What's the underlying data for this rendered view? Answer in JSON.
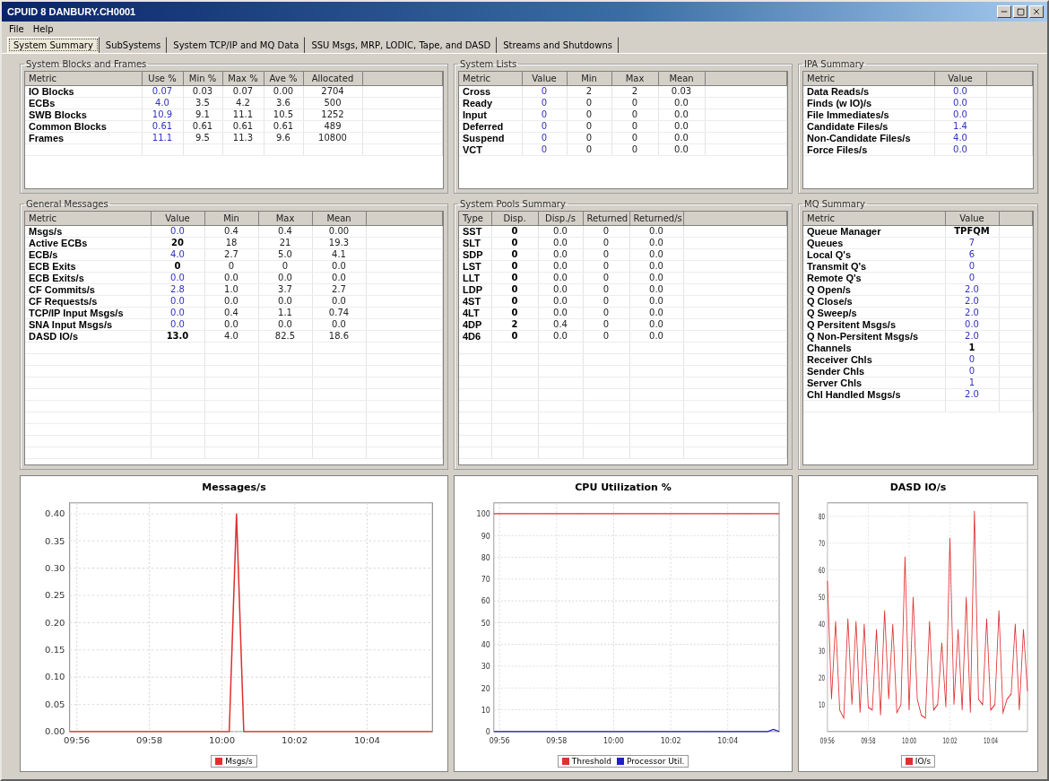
{
  "window": {
    "title": "CPUID 8 DANBURY.CH0001"
  },
  "menu": [
    "File",
    "Help"
  ],
  "tabs": [
    {
      "label": "System Summary",
      "selected": true
    },
    {
      "label": "SubSystems",
      "selected": false
    },
    {
      "label": "System TCP/IP and MQ Data",
      "selected": false
    },
    {
      "label": "SSU Msgs, MRP, LODIC, Tape, and DASD",
      "selected": false
    },
    {
      "label": "Streams and Shutdowns",
      "selected": false
    }
  ],
  "panels": [
    {
      "title": "System Blocks and Frames",
      "columns": [
        "Metric",
        "Use %",
        "Min %",
        "Max %",
        "Ave %",
        "Allocated"
      ],
      "rows": [
        {
          "metric": "IO Blocks",
          "values": [
            "0.07",
            "0.03",
            "0.07",
            "0.00",
            "2704"
          ],
          "highlighted": true
        },
        {
          "metric": "ECBs",
          "values": [
            "4.0",
            "3.5",
            "4.2",
            "3.6",
            "500"
          ],
          "highlighted": true
        },
        {
          "metric": "SWB Blocks",
          "values": [
            "10.9",
            "9.1",
            "11.1",
            "10.5",
            "1252"
          ],
          "highlighted": true
        },
        {
          "metric": "Common Blocks",
          "values": [
            "0.61",
            "0.61",
            "0.61",
            "0.61",
            "489"
          ],
          "highlighted": true
        },
        {
          "metric": "Frames",
          "values": [
            "11.1",
            "9.5",
            "11.3",
            "9.6",
            "10800"
          ],
          "highlighted": true
        }
      ]
    },
    {
      "title": "System Lists",
      "columns": [
        "Metric",
        "Value",
        "Min",
        "Max",
        "Mean"
      ],
      "rows": [
        {
          "metric": "Cross",
          "values": [
            "0",
            "2",
            "2",
            "0.03"
          ],
          "highlighted": true
        },
        {
          "metric": "Ready",
          "values": [
            "0",
            "0",
            "0",
            "0.0"
          ],
          "highlighted": true
        },
        {
          "metric": "Input",
          "values": [
            "0",
            "0",
            "0",
            "0.0"
          ],
          "highlighted": true
        },
        {
          "metric": "Deferred",
          "values": [
            "0",
            "0",
            "0",
            "0.0"
          ],
          "highlighted": true
        },
        {
          "metric": "Suspend",
          "values": [
            "0",
            "0",
            "0",
            "0.0"
          ],
          "highlighted": true
        },
        {
          "metric": "VCT",
          "values": [
            "0",
            "0",
            "0",
            "0.0"
          ],
          "highlighted": true
        }
      ]
    },
    {
      "title": "IPA Summary",
      "columns": [
        "Metric",
        "Value"
      ],
      "rows": [
        {
          "metric": "Data Reads/s",
          "values": [
            "0.0"
          ],
          "highlighted": true
        },
        {
          "metric": "Finds (w IO)/s",
          "values": [
            "0.0"
          ],
          "highlighted": true
        },
        {
          "metric": "File Immediates/s",
          "values": [
            "0.0"
          ],
          "highlighted": true
        },
        {
          "metric": "Candidate Files/s",
          "values": [
            "1.4"
          ],
          "highlighted": true
        },
        {
          "metric": "Non-Candidate Files/s",
          "values": [
            "4.0"
          ],
          "highlighted": true
        },
        {
          "metric": "Force Files/s",
          "values": [
            "0.0"
          ],
          "highlighted": true
        }
      ]
    },
    {
      "title": "General Messages",
      "columns": [
        "Metric",
        "Value",
        "Min",
        "Max",
        "Mean"
      ],
      "rows": [
        {
          "metric": "Msgs/s",
          "values": [
            "0.0",
            "0.4",
            "0.4",
            "0.00"
          ],
          "highlighted": true
        },
        {
          "metric": "Active ECBs",
          "values": [
            "20",
            "18",
            "21",
            "19.3"
          ],
          "highlighted": false
        },
        {
          "metric": "ECB/s",
          "values": [
            "4.0",
            "2.7",
            "5.0",
            "4.1"
          ],
          "highlighted": true
        },
        {
          "metric": "ECB Exits",
          "values": [
            "0",
            "0",
            "0",
            "0.0"
          ],
          "highlighted": false
        },
        {
          "metric": "ECB Exits/s",
          "values": [
            "0.0",
            "0.0",
            "0.0",
            "0.0"
          ],
          "highlighted": true
        },
        {
          "metric": "CF Commits/s",
          "values": [
            "2.8",
            "1.0",
            "3.7",
            "2.7"
          ],
          "highlighted": true
        },
        {
          "metric": "CF Requests/s",
          "values": [
            "0.0",
            "0.0",
            "0.0",
            "0.0"
          ],
          "highlighted": true
        },
        {
          "metric": "TCP/IP Input Msgs/s",
          "values": [
            "0.0",
            "0.4",
            "1.1",
            "0.74"
          ],
          "highlighted": true
        },
        {
          "metric": "SNA Input Msgs/s",
          "values": [
            "0.0",
            "0.0",
            "0.0",
            "0.0"
          ],
          "highlighted": true
        },
        {
          "metric": "DASD IO/s",
          "values": [
            "13.0",
            "4.0",
            "82.5",
            "18.6"
          ],
          "highlighted": false
        }
      ]
    },
    {
      "title": "System Pools Summary",
      "columns": [
        "Type",
        "Disp.",
        "Disp./s",
        "Returned",
        "Returned/s"
      ],
      "rows": [
        {
          "metric": "SST",
          "values": [
            "0",
            "0.0",
            "0",
            "0.0"
          ],
          "highlighted": false
        },
        {
          "metric": "SLT",
          "values": [
            "0",
            "0.0",
            "0",
            "0.0"
          ],
          "highlighted": false
        },
        {
          "metric": "SDP",
          "values": [
            "0",
            "0.0",
            "0",
            "0.0"
          ],
          "highlighted": false
        },
        {
          "metric": "LST",
          "values": [
            "0",
            "0.0",
            "0",
            "0.0"
          ],
          "highlighted": false
        },
        {
          "metric": "LLT",
          "values": [
            "0",
            "0.0",
            "0",
            "0.0"
          ],
          "highlighted": false
        },
        {
          "metric": "LDP",
          "values": [
            "0",
            "0.0",
            "0",
            "0.0"
          ],
          "highlighted": false
        },
        {
          "metric": "4ST",
          "values": [
            "0",
            "0.0",
            "0",
            "0.0"
          ],
          "highlighted": false
        },
        {
          "metric": "4LT",
          "values": [
            "0",
            "0.0",
            "0",
            "0.0"
          ],
          "highlighted": false
        },
        {
          "metric": "4DP",
          "values": [
            "2",
            "0.4",
            "0",
            "0.0"
          ],
          "highlighted": false
        },
        {
          "metric": "4D6",
          "values": [
            "0",
            "0.0",
            "0",
            "0.0"
          ],
          "highlighted": false
        }
      ]
    },
    {
      "title": "MQ Summary",
      "columns": [
        "Metric",
        "Value"
      ],
      "rows": [
        {
          "metric": "Queue Manager",
          "values": [
            "TPFQM"
          ],
          "highlighted": false
        },
        {
          "metric": "Queues",
          "values": [
            "7"
          ],
          "highlighted": true
        },
        {
          "metric": "Local Q's",
          "values": [
            "6"
          ],
          "highlighted": true
        },
        {
          "metric": "Transmit Q's",
          "values": [
            "0"
          ],
          "highlighted": true
        },
        {
          "metric": "Remote Q's",
          "values": [
            "0"
          ],
          "highlighted": true
        },
        {
          "metric": "Q Open/s",
          "values": [
            "2.0"
          ],
          "highlighted": true
        },
        {
          "metric": "Q Close/s",
          "values": [
            "2.0"
          ],
          "highlighted": true
        },
        {
          "metric": "Q Sweep/s",
          "values": [
            "2.0"
          ],
          "highlighted": true
        },
        {
          "metric": "Q Persitent Msgs/s",
          "values": [
            "0.0"
          ],
          "highlighted": true
        },
        {
          "metric": "Q Non-Persitent Msgs/s",
          "values": [
            "2.0"
          ],
          "highlighted": true
        },
        {
          "metric": "Channels",
          "values": [
            "1"
          ],
          "highlighted": false
        },
        {
          "metric": "Receiver Chls",
          "values": [
            "0"
          ],
          "highlighted": true
        },
        {
          "metric": "Sender Chls",
          "values": [
            "0"
          ],
          "highlighted": true
        },
        {
          "metric": "Server Chls",
          "values": [
            "1"
          ],
          "highlighted": true
        },
        {
          "metric": "Chl Handled Msgs/s",
          "values": [
            "2.0"
          ],
          "highlighted": true
        }
      ]
    }
  ],
  "charts": [
    {
      "chart_data": {
        "type": "line",
        "grid": true,
        "legend": "bottom",
        "title": "Messages/s",
        "ylim": [
          0,
          0.42
        ],
        "categories": [
          null,
          "09:56",
          null,
          null,
          null,
          null,
          null,
          null,
          null,
          null,
          null,
          "09:58",
          null,
          null,
          null,
          null,
          null,
          null,
          null,
          null,
          null,
          "10:00",
          null,
          null,
          null,
          null,
          null,
          null,
          null,
          null,
          null,
          "10:02",
          null,
          null,
          null,
          null,
          null,
          null,
          null,
          null,
          null,
          "10:04",
          null,
          null,
          null,
          null,
          null,
          null,
          null,
          null,
          null
        ],
        "yticks": [
          {
            "value": 0,
            "label": "0.00"
          },
          {
            "value": 0.05,
            "label": "0.05"
          },
          {
            "value": 0.1,
            "label": "0.10"
          },
          {
            "value": 0.15,
            "label": "0.15"
          },
          {
            "value": 0.2,
            "label": "0.20"
          },
          {
            "value": 0.25,
            "label": "0.25"
          },
          {
            "value": 0.3,
            "label": "0.30"
          },
          {
            "value": 0.35,
            "label": "0.35"
          },
          {
            "value": 0.4,
            "label": "0.40"
          }
        ],
        "series": [
          {
            "name": "Msgs/s",
            "color": "#e03030",
            "values": [
              0,
              0,
              0,
              0,
              0,
              0,
              0,
              0,
              0,
              0,
              0,
              0,
              0,
              0,
              0,
              0,
              0,
              0,
              0,
              0,
              0,
              0,
              0,
              0.4,
              0,
              0,
              0,
              0,
              0,
              0,
              0,
              0,
              0,
              0,
              0,
              0,
              0,
              0,
              0,
              0,
              0,
              0,
              0,
              0,
              0,
              0,
              0,
              0,
              0,
              0,
              0
            ]
          }
        ]
      }
    },
    {
      "chart_data": {
        "type": "line",
        "grid": true,
        "legend": "bottom",
        "title": "CPU Utilization %",
        "ylim": [
          0,
          105
        ],
        "categories": [
          null,
          "09:56",
          null,
          null,
          null,
          null,
          null,
          null,
          null,
          null,
          null,
          "09:58",
          null,
          null,
          null,
          null,
          null,
          null,
          null,
          null,
          null,
          "10:00",
          null,
          null,
          null,
          null,
          null,
          null,
          null,
          null,
          null,
          "10:02",
          null,
          null,
          null,
          null,
          null,
          null,
          null,
          null,
          null,
          "10:04",
          null,
          null,
          null,
          null,
          null,
          null,
          null,
          null,
          null
        ],
        "yticks": [
          0,
          10,
          20,
          30,
          40,
          50,
          60,
          70,
          80,
          90,
          100
        ],
        "series": [
          {
            "name": "Threshold",
            "color": "#e03030",
            "values": [
              100,
              100,
              100,
              100,
              100,
              100,
              100,
              100,
              100,
              100,
              100,
              100,
              100,
              100,
              100,
              100,
              100,
              100,
              100,
              100,
              100,
              100,
              100,
              100,
              100,
              100,
              100,
              100,
              100,
              100,
              100,
              100,
              100,
              100,
              100,
              100,
              100,
              100,
              100,
              100,
              100,
              100,
              100,
              100,
              100,
              100,
              100,
              100,
              100,
              100,
              100
            ]
          },
          {
            "name": "Processor Util.",
            "color": "#2020c0",
            "values": [
              0,
              0,
              0,
              0,
              0,
              0,
              0,
              0,
              0,
              0,
              0,
              0,
              0,
              0,
              0,
              0,
              0,
              0,
              0,
              0,
              0,
              0,
              0,
              0,
              0,
              0,
              0,
              0,
              0,
              0,
              0,
              0,
              0,
              0,
              0,
              0,
              0,
              0,
              0,
              0,
              0,
              0,
              0,
              0,
              0,
              0,
              0,
              0,
              0,
              1,
              0
            ]
          }
        ]
      }
    },
    {
      "chart_data": {
        "type": "line",
        "grid": true,
        "legend": "bottom",
        "title": "DASD IO/s",
        "ylim": [
          0,
          85
        ],
        "categories": [
          "09:56",
          null,
          null,
          null,
          null,
          null,
          null,
          null,
          null,
          null,
          "09:58",
          null,
          null,
          null,
          null,
          null,
          null,
          null,
          null,
          null,
          "10:00",
          null,
          null,
          null,
          null,
          null,
          null,
          null,
          null,
          null,
          "10:02",
          null,
          null,
          null,
          null,
          null,
          null,
          null,
          null,
          null,
          "10:04",
          null,
          null,
          null,
          null,
          null,
          null,
          null,
          null,
          null
        ],
        "yticks": [
          10,
          20,
          30,
          40,
          50,
          60,
          70,
          80
        ],
        "series": [
          {
            "name": "IO/s",
            "color": "#e03030",
            "values": [
              56,
              12,
              41,
              8,
              5,
              42,
              10,
              41,
              7,
              40,
              9,
              8,
              38,
              6,
              45,
              12,
              40,
              7,
              10,
              65,
              8,
              50,
              12,
              6,
              5,
              41,
              8,
              10,
              33,
              9,
              72,
              10,
              38,
              8,
              50,
              7,
              82,
              12,
              10,
              42,
              8,
              10,
              45,
              7,
              12,
              14,
              40,
              8,
              38,
              15
            ]
          }
        ]
      }
    }
  ]
}
